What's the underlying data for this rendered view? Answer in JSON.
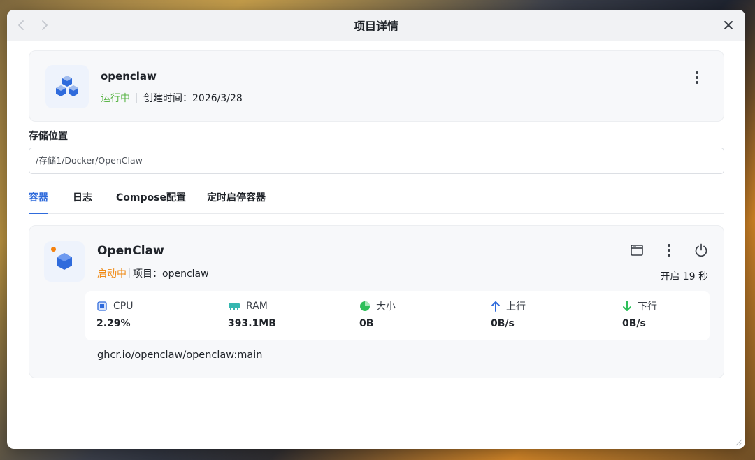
{
  "window": {
    "title": "项目详情",
    "nav_back": "‹",
    "nav_forward": "›"
  },
  "project": {
    "name": "openclaw",
    "status": "运行中",
    "created": "创建时间：2026/3/28"
  },
  "storage": {
    "label": "存储位置",
    "path": "/存储1/Docker/OpenClaw"
  },
  "tabs": [
    {
      "label": "容器",
      "active": true
    },
    {
      "label": "日志",
      "active": false
    },
    {
      "label": "Compose配置",
      "active": false
    },
    {
      "label": "定时启停容器",
      "active": false
    }
  ],
  "container": {
    "name": "OpenClaw",
    "status": "启动中",
    "project": "项目：openclaw",
    "uptime": "开启 19 秒",
    "image": "ghcr.io/openclaw/openclaw:main",
    "stats": [
      {
        "label": "CPU",
        "value": "2.29%",
        "icon": "cpu-icon"
      },
      {
        "label": "RAM",
        "value": "393.1MB",
        "icon": "ram-icon"
      },
      {
        "label": "大小",
        "value": "0B",
        "icon": "pie-icon"
      },
      {
        "label": "上行",
        "value": "0B/s",
        "icon": "arrow-up-icon"
      },
      {
        "label": "下行",
        "value": "0B/s",
        "icon": "arrow-down-icon"
      }
    ]
  },
  "colors": {
    "accent": "#2f6bdc",
    "running": "#5bb548",
    "starting": "#f08a14"
  }
}
